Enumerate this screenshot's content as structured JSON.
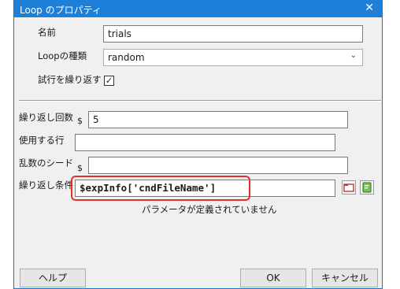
{
  "dialog": {
    "title": "Loop のプロパティ",
    "close_glyph": "✕"
  },
  "fields": {
    "name_label": "名前",
    "name_value": "trials",
    "looptype_label": "Loopの種類",
    "looptype_value": "random",
    "isTrials_label": "試行を繰り返す",
    "isTrials_checked": true,
    "isTrials_glyph": "✓",
    "nReps_label": "繰り返し回数",
    "nReps_prefix": "$",
    "nReps_value": "5",
    "selectedRows_label": "使用する行",
    "selectedRows_value": "",
    "randomSeed_label": "乱数のシード",
    "randomSeed_prefix": "$",
    "randomSeed_value": "",
    "conditions_label": "繰り返し条件",
    "conditions_value": "$expInfo['cndFileName']",
    "conditions_message": "パラメータが定義されていません"
  },
  "icons": {
    "browse": "folder-open-icon",
    "edit": "edit-conditions-icon"
  },
  "buttons": {
    "help": "ヘルプ",
    "ok": "OK",
    "cancel": "キャンセル"
  },
  "colors": {
    "titlebar": "#1e7fd8",
    "highlight": "#e0312b"
  }
}
